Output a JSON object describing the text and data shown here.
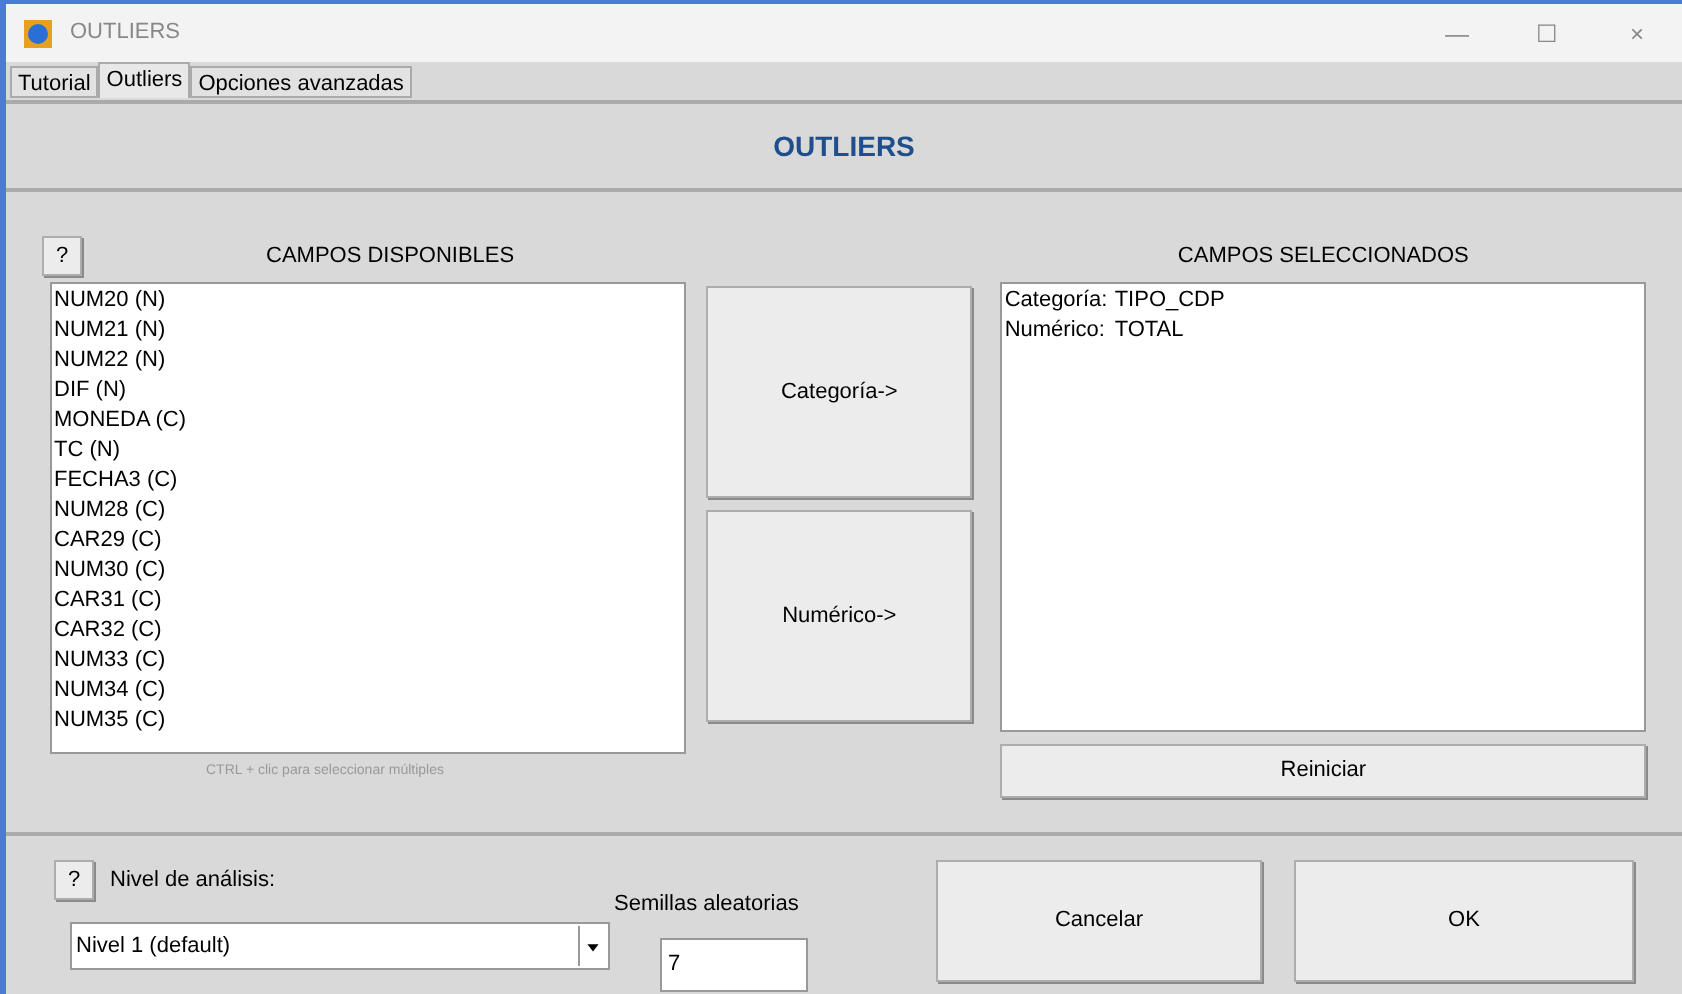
{
  "window": {
    "title": "OUTLIERS",
    "controls": [
      "—",
      "☐",
      "×"
    ]
  },
  "tabs": [
    {
      "label": "Tutorial",
      "selected": false
    },
    {
      "label": "Outliers",
      "selected": true
    },
    {
      "label": "Opciones avanzadas",
      "selected": false
    }
  ],
  "header": "OUTLIERS",
  "help_button": "?",
  "available": {
    "title": "CAMPOS DISPONIBLES",
    "items": [
      "NUM20 (N)",
      "NUM21 (N)",
      "NUM22 (N)",
      "DIF (N)",
      "MONEDA (C)",
      "TC (N)",
      "FECHA3 (C)",
      "NUM28 (C)",
      "CAR29 (C)",
      "NUM30 (C)",
      "CAR31 (C)",
      "CAR32 (C)",
      "NUM33 (C)",
      "NUM34 (C)",
      "NUM35 (C)"
    ],
    "hint": "CTRL + clic para seleccionar múltiples"
  },
  "move_buttons": [
    "Categoría->",
    "Numérico->"
  ],
  "selected_fields": {
    "title": "CAMPOS SELECCIONADOS",
    "items": [
      {
        "label": "Categoría:",
        "value": "TIPO_CDP"
      },
      {
        "label": "Numérico:",
        "value": "TOTAL"
      }
    ]
  },
  "reset_button": "Reiniciar",
  "analysis": {
    "help_button": "?",
    "label": "Nivel de análisis:",
    "value": "Nivel 1 (default)"
  },
  "seeds": {
    "label": "Semillas aleatorias",
    "value": "7"
  },
  "buttons": [
    "Cancelar",
    "OK"
  ]
}
